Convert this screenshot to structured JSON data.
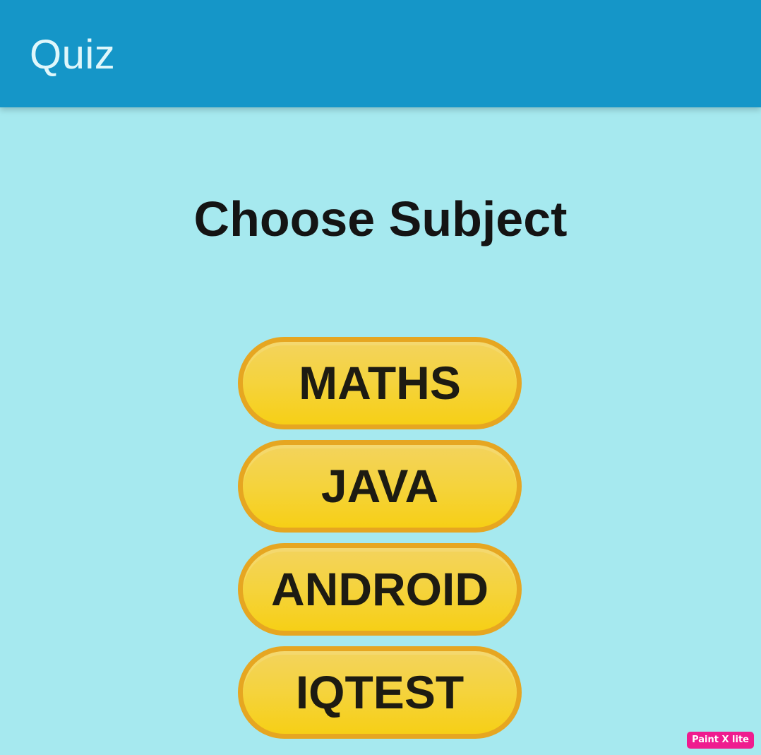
{
  "app_bar": {
    "title": "Quiz"
  },
  "main": {
    "heading": "Choose Subject",
    "subjects": [
      {
        "label": "MATHS"
      },
      {
        "label": "JAVA"
      },
      {
        "label": "ANDROID"
      },
      {
        "label": "IQTEST"
      }
    ]
  },
  "watermark": {
    "text": "Paint X lite"
  },
  "colors": {
    "app_bar": "#1596c8",
    "background": "#a6e9ef",
    "button_fill": "#f5d33b",
    "button_border": "#e6a621",
    "watermark": "#ef1c8f"
  }
}
